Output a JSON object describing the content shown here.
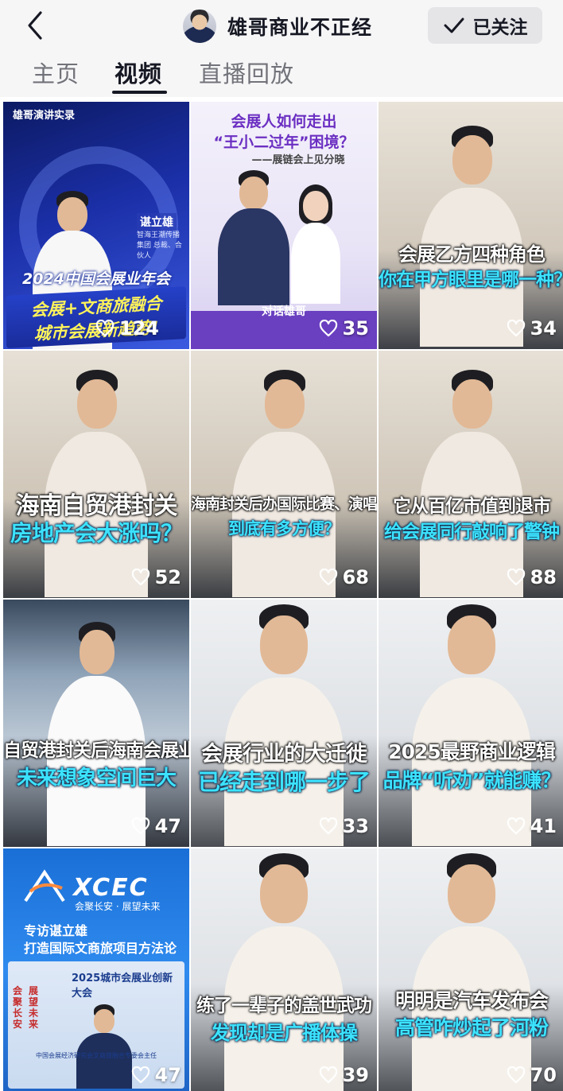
{
  "header": {
    "back_icon": "chevron-left-icon",
    "account_name": "雄哥商业不正经",
    "follow_button_label": "已关注",
    "follow_icon": "checkmark-icon"
  },
  "tabs": [
    {
      "label": "主页",
      "active": false
    },
    {
      "label": "视频",
      "active": true
    },
    {
      "label": "直播回放",
      "active": false
    }
  ],
  "videos": [
    {
      "likes": "124",
      "promo": {
        "tag": "雄哥演讲实录",
        "name": "谌立雄",
        "subtitle": "智海王潮传播集团 总裁、合伙人",
        "title": "2024中国会展业年会",
        "banner_line1": "会展+文商旅融合",
        "banner_line2": "城市会展新趋势!"
      }
    },
    {
      "likes": "35",
      "promo": {
        "title_line1": "会展人如何走出",
        "title_line2": "“王小二过年”困境？",
        "title_line3": "——展链会上见分晓",
        "bottom": "对话雄哥"
      }
    },
    {
      "likes": "34",
      "caption_line1": "会展乙方四种角色",
      "caption_line2": "你在甲方眼里是哪一种？"
    },
    {
      "likes": "52",
      "caption_line1": "海南自贸港封关",
      "caption_line2": "房地产会大涨吗？"
    },
    {
      "likes": "68",
      "caption_line1": "海南封关后办国际比赛、演唱会",
      "caption_line2": "到底有多方便？"
    },
    {
      "likes": "88",
      "caption_line1": "它从百亿市值到退市",
      "caption_line2": "给会展同行敲响了警钟"
    },
    {
      "likes": "47",
      "caption_line1": "自贸港封关后海南会展业",
      "caption_line2": "未来想象空间巨大"
    },
    {
      "likes": "33",
      "caption_line1": "会展行业的大迁徙",
      "caption_line2": "已经走到哪一步了"
    },
    {
      "likes": "41",
      "caption_line1": "2025最野商业逻辑",
      "caption_line2": "品牌“听劝”就能赚？"
    },
    {
      "likes": "47",
      "promo": {
        "logo": "XCEC",
        "slogan": "会聚长安 · 展望未来",
        "heading_line1": "专访谌立雄",
        "heading_line2": "打造国际文商旅项目方法论",
        "inner_title": "2025城市会展业创新大会",
        "vertical_left": "会聚长安",
        "vertical_right": "展望未来",
        "footer": "中国会展经济研究会文商旅融合专委会主任"
      }
    },
    {
      "likes": "39",
      "caption_line1": "练了一辈子的盖世武功",
      "caption_line2": "发现却是广播体操"
    },
    {
      "likes": "70",
      "caption_line1": "明明是汽车发布会",
      "caption_line2": "高管咋炒起了河粉"
    }
  ],
  "like_icon": "heart-outline-icon"
}
